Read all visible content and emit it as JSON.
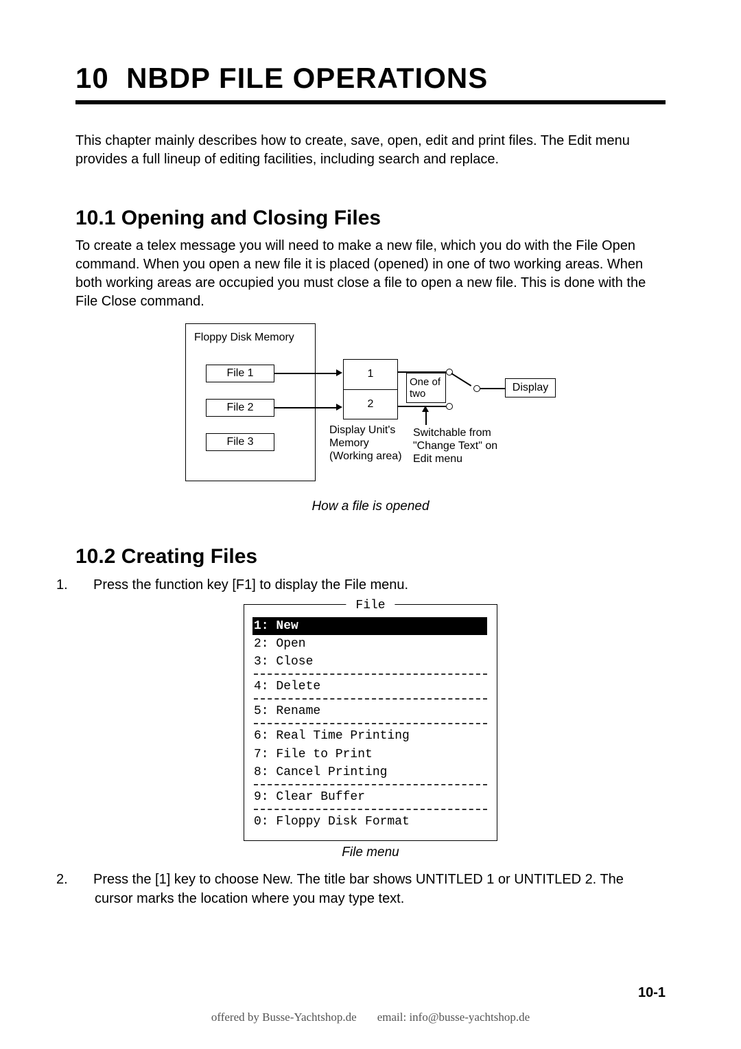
{
  "chapter": {
    "number": "10",
    "title": "NBDP FILE OPERATIONS",
    "intro": "This chapter mainly describes how to create, save, open, edit and print files. The Edit menu provides a full lineup of editing facilities, including search and replace."
  },
  "section1": {
    "heading": "10.1 Opening and Closing Files",
    "body": "To create a telex message you will need to make a new file, which you do with the File Open command. When you open a new file it is placed (opened) in one of two working areas. When both working areas are occupied you must close a file to open a new file. This is done with the File Close command.",
    "diagram": {
      "floppy_label": "Floppy Disk Memory",
      "files": [
        "File 1",
        "File 2",
        "File 3"
      ],
      "slots": [
        "1",
        "2"
      ],
      "working_area_label": "Display Unit's\nMemory\n(Working area)",
      "select_label": "One of\ntwo",
      "display_label": "Display",
      "switch_note": "Switchable from\n\"Change Text\" on\nEdit menu"
    },
    "caption": "How a file is opened"
  },
  "section2": {
    "heading": "10.2 Creating Files",
    "steps": [
      "Press the function key [F1] to display the File menu.",
      "Press the [1] key to choose New. The title bar shows UNTITLED 1 or UNTITLED 2. The cursor marks the location where you may type text."
    ],
    "filemenu": {
      "title": "File",
      "items": [
        {
          "n": "1",
          "label": "New",
          "selected": true
        },
        {
          "n": "2",
          "label": "Open"
        },
        {
          "n": "3",
          "label": "Close"
        },
        {
          "sep": true
        },
        {
          "n": "4",
          "label": "Delete"
        },
        {
          "sep": true
        },
        {
          "n": "5",
          "label": "Rename"
        },
        {
          "sep": true
        },
        {
          "n": "6",
          "label": "Real Time Printing"
        },
        {
          "n": "7",
          "label": "File to Print"
        },
        {
          "n": "8",
          "label": "Cancel Printing"
        },
        {
          "sep": true
        },
        {
          "n": "9",
          "label": "Clear Buffer"
        },
        {
          "sep": true
        },
        {
          "n": "0",
          "label": "Floppy Disk Format"
        }
      ]
    },
    "caption": "File menu"
  },
  "page_number": "10-1",
  "footer": {
    "offered": "offered by Busse-Yachtshop.de",
    "email_label": "email:",
    "email": "info@busse-yachtshop.de"
  }
}
